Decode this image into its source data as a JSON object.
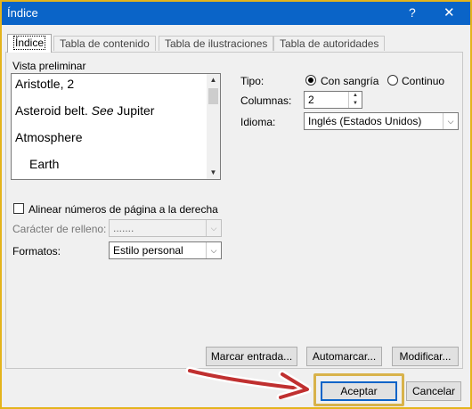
{
  "window": {
    "title": "Índice",
    "help_glyph": "?",
    "close_glyph": "✕"
  },
  "tabs": [
    {
      "label": "Índice",
      "active": true
    },
    {
      "label": "Tabla de contenido",
      "active": false
    },
    {
      "label": "Tabla de ilustraciones",
      "active": false
    },
    {
      "label": "Tabla de autoridades",
      "active": false
    }
  ],
  "preview": {
    "label": "Vista preliminar",
    "entries": [
      {
        "text": "Aristotle, 2"
      },
      {
        "text_before": "Asteroid belt. ",
        "italic": "See",
        "text_after": " Jupiter"
      },
      {
        "text": "Atmosphere"
      },
      {
        "text": "Earth"
      }
    ]
  },
  "tipo": {
    "label": "Tipo:",
    "options": [
      {
        "label": "Con sangría",
        "selected": true
      },
      {
        "label": "Continuo",
        "selected": false
      }
    ]
  },
  "columnas": {
    "label": "Columnas:",
    "value": "2"
  },
  "idioma": {
    "label": "Idioma:",
    "value": "Inglés (Estados Unidos)"
  },
  "alinear": {
    "label": "Alinear números de página a la derecha",
    "checked": false
  },
  "caracter_relleno": {
    "label": "Carácter de relleno:",
    "value": ".......",
    "enabled": false
  },
  "formatos": {
    "label": "Formatos:",
    "value": "Estilo personal"
  },
  "buttons": {
    "marcar_entrada": "Marcar entrada...",
    "automarcar": "Automarcar...",
    "modificar": "Modificar...",
    "aceptar": "Aceptar",
    "cancelar": "Cancelar"
  },
  "colors": {
    "titlebar": "#0a64c8",
    "highlight": "#d8b24a",
    "arrow": "#c03030"
  },
  "icons": {
    "help": "question-mark-icon",
    "close": "close-icon",
    "dropdown": "chevron-down-icon",
    "spin_up": "spin-up-icon",
    "spin_down": "spin-down-icon",
    "annotation": "hand-drawn-arrow"
  }
}
